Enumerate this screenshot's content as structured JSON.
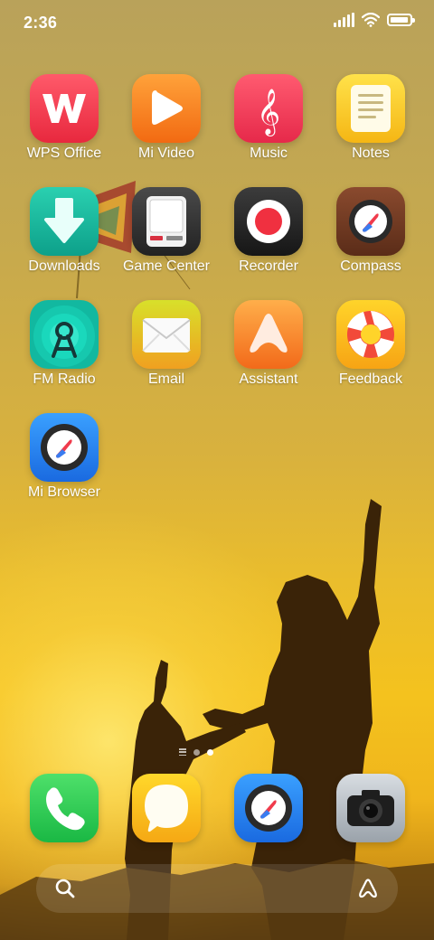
{
  "status_bar": {
    "time": "2:36"
  },
  "apps": [
    {
      "label": "WPS Office",
      "icon": "wps-office-icon"
    },
    {
      "label": "Mi Video",
      "icon": "mi-video-icon"
    },
    {
      "label": "Music",
      "icon": "music-icon"
    },
    {
      "label": "Notes",
      "icon": "notes-icon"
    },
    {
      "label": "Downloads",
      "icon": "downloads-icon"
    },
    {
      "label": "Game Center",
      "icon": "game-center-icon"
    },
    {
      "label": "Recorder",
      "icon": "recorder-icon"
    },
    {
      "label": "Compass",
      "icon": "compass-icon"
    },
    {
      "label": "FM Radio",
      "icon": "fm-radio-icon"
    },
    {
      "label": "Email",
      "icon": "email-icon"
    },
    {
      "label": "Assistant",
      "icon": "assistant-icon"
    },
    {
      "label": "Feedback",
      "icon": "feedback-icon"
    },
    {
      "label": "Mi Browser",
      "icon": "mi-browser-icon"
    }
  ],
  "dock": [
    {
      "icon": "phone-icon"
    },
    {
      "icon": "messaging-icon"
    },
    {
      "icon": "browser-icon"
    },
    {
      "icon": "camera-icon"
    }
  ],
  "pages": {
    "current": 2,
    "total": 2
  },
  "colors": {
    "wallpaper_top": "#b9a25a",
    "wallpaper_mid": "#f4c21e",
    "text": "#ffffff"
  }
}
